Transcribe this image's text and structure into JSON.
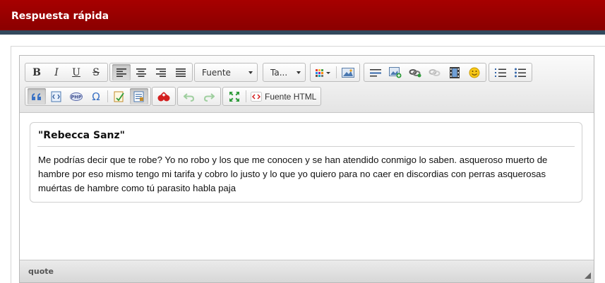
{
  "header": {
    "title": "Respuesta rápida"
  },
  "toolbar": {
    "bold": "B",
    "italic": "I",
    "underline": "U",
    "strike": "S",
    "font_label": "Fuente",
    "size_label": "Ta...",
    "special_char": "Ω",
    "source_label": "Fuente HTML"
  },
  "quote": {
    "title": "\"Rebecca Sanz\"",
    "body": "Me podrías decir que te robe? Yo no robo y los que me conocen y se han atendido conmigo lo saben.  asqueroso muerto de hambre por eso mismo tengo mi tarifa y cobro lo justo y lo que yo quiero para no caer en discordias con perras asquerosas muértas de hambre como tú parasito habla paja"
  },
  "statusbar": {
    "path": "quote"
  },
  "colors": {
    "header": "#9b0000",
    "header_stripe": "#33495d"
  }
}
